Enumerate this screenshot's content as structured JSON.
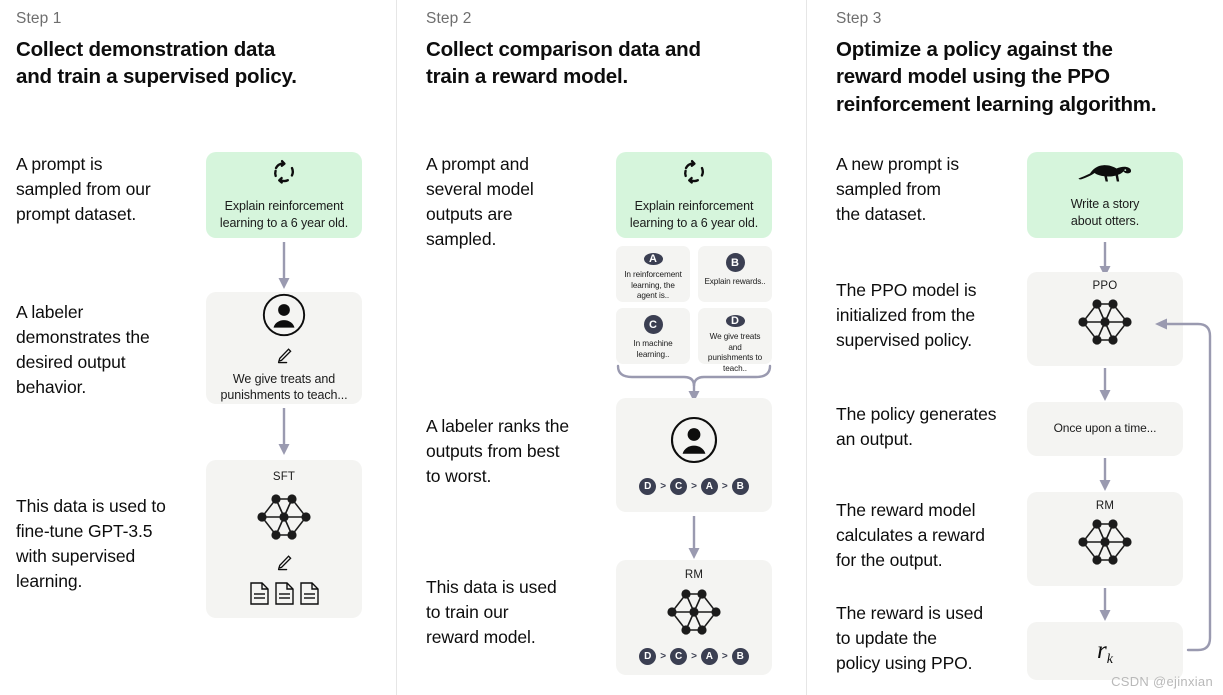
{
  "colors": {
    "green_card": "#d6f5dc",
    "grey_card": "#f4f4f2",
    "badge_dark": "#3b3f52",
    "arrow": "#9a9ab0",
    "divider": "#e6e6e6",
    "text": "#0d0d0d",
    "muted_text": "#6e6e6e"
  },
  "watermark": "CSDN @ejinxian",
  "columns": [
    {
      "step_label": "Step 1",
      "step_title": "Collect demonstration data\nand train a supervised policy.",
      "captions": [
        "A prompt is\nsampled from our\nprompt dataset.",
        "A labeler\ndemonstrates the\ndesired output\nbehavior.",
        "This data is used to\nfine-tune GPT-3.5\nwith supervised\nlearning."
      ],
      "boxes": [
        {
          "kind": "green",
          "icon": "refresh-cycle-icon",
          "text": "Explain reinforcement\nlearning to a 6 year old."
        },
        {
          "kind": "grey",
          "icon": "person-icon",
          "icon2": "pencil-icon",
          "text": "We give treats and\npunishments to teach..."
        },
        {
          "kind": "grey",
          "title": "SFT",
          "icon": "neural-network-icon",
          "icon2": "pencil-icon",
          "icon3": "documents-icon"
        }
      ]
    },
    {
      "step_label": "Step 2",
      "step_title": "Collect comparison data and\ntrain a reward model.",
      "captions": [
        "A prompt and\nseveral model\noutputs are\nsampled.",
        "A labeler ranks the\noutputs from best\nto worst.",
        "This data is used\nto train our\nreward model."
      ],
      "boxes": [
        {
          "kind": "green",
          "icon": "refresh-cycle-icon",
          "text": "Explain reinforcement\nlearning to a 6 year old."
        },
        {
          "kind": "grey",
          "icon": "person-icon",
          "ranking": [
            "D",
            "C",
            "A",
            "B"
          ]
        },
        {
          "kind": "grey",
          "title": "RM",
          "icon": "neural-network-icon",
          "ranking": [
            "D",
            "C",
            "A",
            "B"
          ]
        }
      ],
      "samples": [
        {
          "badge": "A",
          "text": "In reinforcement\nlearning, the\nagent is.."
        },
        {
          "badge": "B",
          "text": "Explain rewards.."
        },
        {
          "badge": "C",
          "text": "In machine\nlearning.."
        },
        {
          "badge": "D",
          "text": "We give treats and\npunishments to\nteach.."
        }
      ],
      "rank_separator": ">"
    },
    {
      "step_label": "Step 3",
      "step_title": "Optimize a policy against the\nreward model using the PPO\nreinforcement learning algorithm.",
      "captions": [
        "A new prompt is\nsampled from\nthe dataset.",
        "The PPO model is\ninitialized from the\nsupervised policy.",
        "The policy generates\nan output.",
        "The reward model\ncalculates a reward\nfor the output.",
        "The reward is used\nto update the\npolicy using PPO."
      ],
      "boxes": [
        {
          "kind": "green",
          "icon": "otter-icon",
          "text": "Write a story\nabout otters."
        },
        {
          "kind": "grey",
          "title": "PPO",
          "icon": "neural-network-icon"
        },
        {
          "kind": "grey",
          "text": "Once upon a time..."
        },
        {
          "kind": "grey",
          "title": "RM",
          "icon": "neural-network-icon"
        },
        {
          "kind": "grey",
          "formula": "r",
          "formula_sub": "k"
        }
      ]
    }
  ]
}
